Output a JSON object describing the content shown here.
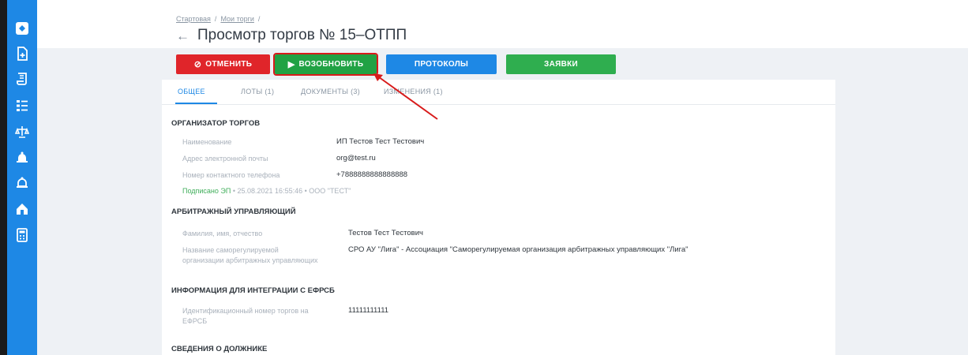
{
  "breadcrumb": {
    "home": "Стартовая",
    "sep1": "/",
    "my_trades": "Мои торги",
    "sep2": "/"
  },
  "page": {
    "back_icon": "←",
    "title": "Просмотр торгов № 15–ОТПП"
  },
  "actions": {
    "cancel": "ОТМЕНИТЬ",
    "resume": "ВОЗОБНОВИТЬ",
    "protocols": "ПРОТОКОЛЫ",
    "bids": "ЗАЯВКИ"
  },
  "tabs": [
    {
      "label": "ОБЩЕЕ"
    },
    {
      "label": "ЛОТЫ (1)"
    },
    {
      "label": "ДОКУМЕНТЫ (3)"
    },
    {
      "label": "ИЗМЕНЕНИЯ (1)"
    }
  ],
  "organizer": {
    "title": "ОРГАНИЗАТОР ТОРГОВ",
    "name_label": "Наименование",
    "name_value": "ИП Тестов Тест Тестович",
    "email_label": "Адрес электронной почты",
    "email_value": "org@test.ru",
    "phone_label": "Номер контактного телефона",
    "phone_value": "+7888888888888888",
    "signed_label": "Подписано ЭП",
    "signed_rest": " • 25.08.2021 16:55:46 • ООО \"ТЕСТ\""
  },
  "manager": {
    "title": "АРБИТРАЖНЫЙ УПРАВЛЯЮЩИЙ",
    "fio_label": "Фамилия, имя, отчество",
    "fio_value": "Тестов Тест Тестович",
    "sro_label_1": "Название саморегулируемой",
    "sro_label_2": "организации арбитражных управляющих",
    "sro_value": "СРО АУ \"Лига\" - Ассоциация \"Саморегулируемая организация арбитражных управляющих \"Лига\""
  },
  "efrsb": {
    "title": "ИНФОРМАЦИЯ ДЛЯ ИНТЕГРАЦИИ С ЕФРСБ",
    "id_label_1": "Идентификационный номер торгов на",
    "id_label_2": "ЕФРСБ",
    "id_value": "11111111111"
  },
  "debtor": {
    "title": "СВЕДЕНИЯ О ДОЛЖНИКЕ"
  },
  "sidebar_icons": [
    "logo-icon",
    "document-plus-icon",
    "scroll-icon",
    "list-icon",
    "scales-icon",
    "bell-icon",
    "bell-outline-icon",
    "home-icon",
    "calculator-icon"
  ],
  "colors": {
    "sidebar": "#1e88e5",
    "cancel": "#e0252a",
    "resume": "#21a244",
    "protocols": "#1e88e5",
    "bids": "#2fae4f",
    "annotation": "#d81b1b"
  }
}
